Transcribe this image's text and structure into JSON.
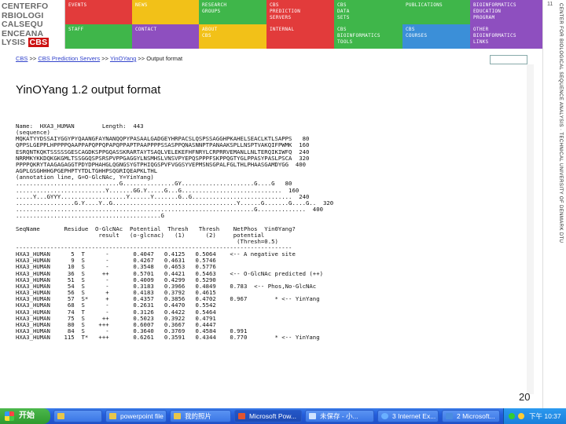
{
  "logo": {
    "lines": [
      "CENTERFO",
      "RBIOLOGI",
      "CALSEQU",
      "ENCEANA"
    ],
    "last_line": "LYSIS",
    "badge": "CBS"
  },
  "nav": [
    {
      "label": "EVENTS",
      "color": "#e23b3b"
    },
    {
      "label": "NEWS",
      "color": "#f2c118"
    },
    {
      "label": "RESEARCH\nGROUPS",
      "color": "#3fb64a"
    },
    {
      "label": "CBS\nPREDICTION\nSERVERS",
      "color": "#e23b3b"
    },
    {
      "label": "CBS\nDATA\nSETS",
      "color": "#3fb64a"
    },
    {
      "label": "PUBLICATIONS",
      "color": "#3fb64a"
    },
    {
      "label": "BIOINFORMATICS\nEDUCATION\nPROGRAM",
      "color": "#8e4fbf"
    },
    {
      "label": "STAFF",
      "color": "#3fb64a"
    },
    {
      "label": "CONTACT",
      "color": "#8e4fbf"
    },
    {
      "label": "ABOUT\nCBS",
      "color": "#f2c118"
    },
    {
      "label": "INTERNAL",
      "color": "#e23b3b"
    },
    {
      "label": "CBS\nBIOINFORMATICS\nTOOLS",
      "color": "#3fb64a"
    },
    {
      "label": "CBS\nCOURSES",
      "color": "#3b8fd8"
    },
    {
      "label": "OTHER\nBIOINFORMATICS\nLINKS",
      "color": "#8e4fbf"
    }
  ],
  "side_text": "CENTER FOR BIOLOGICAL SEQUENCE ANALYSIS  ·  TECHNICAL UNIVERSITY OF DENMARK DTU",
  "side_top": "11",
  "breadcrumb": {
    "items": [
      "CBS",
      "CBS Prediction Servers",
      "YinOYang"
    ],
    "sep": " >> ",
    "current": "Output format"
  },
  "page_title": "YinOYang 1.2 output format",
  "output_text": "Name:  HXA3_HUMAN        Length:  443\n(sequence)\nMQKATYYDSSAIYGGYPYQAANGFAYNANQQPYPASAALGADGEYHRPACSLQSPSSAGGHPKAHELSEACLKTLSAPPS   80\nQPPSLGEPPLHPPPPQAAPPAPQPPQPAPQPPAPTPAAPPPPSSASPPQNASNNPTPANAAKSPLLNSPTVAKQIFPWMK  160\nESRQNTKQKTSSSSSGESCAGDKSPPGQASSKRARTAYTSAQLVELEKEFHFNRYLCRPRRVEMANLLNLTERQIKIWFQ  240\nNRRMKYKKDQKGKGMLTSSGGQSPSRSPVPPGAGGYLNSMHSLVNSVPYEPQSPPPFSKPPQGTYGLPPASYPASLPSCA  320\nPPPPQKRYTAAGAGAGGTPDYDPHAHGLQGNGSYGTPHIQGSPVFVGGSYVEPMSNSGPALFGLTHLPHAASGAMDYGG  400\nAGPLGSGHHHGPGEPHPTYTDLTGHHPSQGRIQEAPKLTHL\n(annotation line, G=O-GlcNAc, Y=YinYang)\n..............................G...............GY.....................G....G   80\n..........................Y.......GG.Y.....G...G.............................  160\n.....Y...GYYY...................Y......Y.......G..G.............................  240\n.................G.Y....Y..G....................................Y......G.......G....G..  320\n.....................................................................G..............  400\n..........................................G\n\nSeqName       Residue  O-GlcNAc  Potential  Thresh   Thresh    NetPhos  Yin0Yang?\n                        result   (o-glcnac)   (1)      (2)     potential\n                                                                (Thresh=0.5)\n--------------------------------------------------------------------------------\nHXA3_HUMAN      5  T      -       0.4047   0.4125   0.5064    <-- A negative site\nHXA3_HUMAN      9  S      -       0.4267   0.4631   0.5746\nHXA3_HUMAN     10  S      -       0.3548   0.4653   0.5776\nHXA3_HUMAN     36  S     ++       0.5701   0.4421   0.5463    <-- O-GlcNAc predicted (++)\nHXA3_HUMAN     51  S      -       0.4009   0.4299   0.5290\nHXA3_HUMAN     54  S      -       0.3183   0.3966   0.4849    0.783  <-- Phos,No-GlcNAc\nHXA3_HUMAN     56  S      +       0.4183   0.3792   0.4615\nHXA3_HUMAN     57  S*     +       0.4357   0.3856   0.4702    0.967        * <-- YinYang\nHXA3_HUMAN     68  S      -       0.2631   0.4470   0.5542\nHXA3_HUMAN     74  T      -       0.3126   0.4422   0.5464\nHXA3_HUMAN     75  S     ++       0.5023   0.3922   0.4791\nHXA3_HUMAN     80  S    +++       0.6007   0.3667   0.4447\nHXA3_HUMAN     84  S      -       0.3640   0.3769   0.4584    0.991\nHXA3_HUMAN    115  T*   +++       0.6261   0.3591   0.4344    0.770        * <-- YinYang",
  "page_number": "20",
  "taskbar": {
    "start_label": "开始",
    "buttons": [
      "",
      "powerpoint file",
      "我的照片",
      "Microsoft Pow...",
      "未保存 - 小...",
      "3 Internet Ex...",
      "2 Microsoft..."
    ],
    "clock": "下午 10:37"
  }
}
